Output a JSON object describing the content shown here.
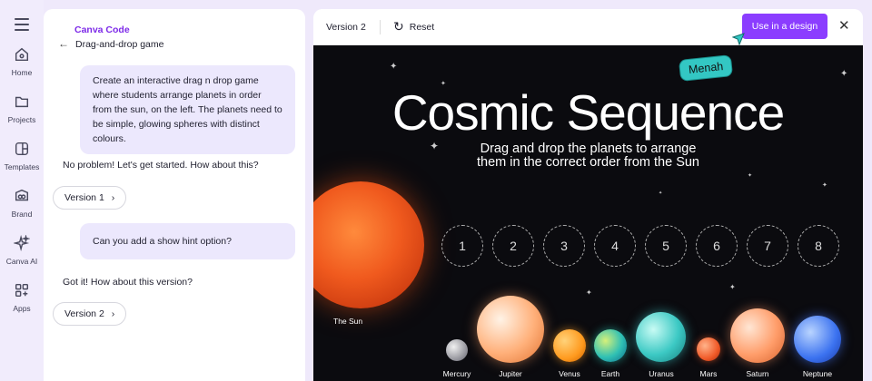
{
  "rail": {
    "items": [
      {
        "label": "Home",
        "icon": "home-icon"
      },
      {
        "label": "Projects",
        "icon": "folder-icon"
      },
      {
        "label": "Templates",
        "icon": "templates-icon"
      },
      {
        "label": "Brand",
        "icon": "brand-icon"
      },
      {
        "label": "Canva AI",
        "icon": "sparkle-icon"
      },
      {
        "label": "Apps",
        "icon": "apps-icon"
      }
    ]
  },
  "chat": {
    "title": "Canva Code",
    "subtitle": "Drag-and-drop game",
    "messages": [
      {
        "role": "user",
        "text": "Create an interactive drag n drop game where students arrange planets in order from the sun, on the left. The planets need to be simple, glowing spheres with distinct colours."
      },
      {
        "role": "assistant",
        "text": "No problem! Let's get started. How about this?"
      },
      {
        "role": "version",
        "text": "Version 1"
      },
      {
        "role": "user",
        "text": "Can you add a show hint option?"
      },
      {
        "role": "assistant",
        "text": "Got it! How about this version?"
      },
      {
        "role": "version",
        "text": "Version 2"
      }
    ]
  },
  "toolbar": {
    "version": "Version 2",
    "reset": "Reset",
    "use_button": "Use in a design",
    "close": "✕"
  },
  "collaborator": {
    "name": "Menah",
    "color": "#33c7c3"
  },
  "game": {
    "title": "Cosmic Sequence",
    "subtitle_line1": "Drag and drop the planets to arrange",
    "subtitle_line2": "them in the correct order from the Sun",
    "sun_label": "The Sun",
    "slots": [
      "1",
      "2",
      "3",
      "4",
      "5",
      "6",
      "7",
      "8"
    ],
    "planets": [
      {
        "name": "Mercury"
      },
      {
        "name": "Jupiter"
      },
      {
        "name": "Venus"
      },
      {
        "name": "Earth"
      },
      {
        "name": "Uranus"
      },
      {
        "name": "Mars"
      },
      {
        "name": "Saturn"
      },
      {
        "name": "Neptune"
      }
    ]
  },
  "colors": {
    "accent": "#8b3dff",
    "brand_text": "#7d2ae8",
    "bubble": "#ece8fd"
  }
}
